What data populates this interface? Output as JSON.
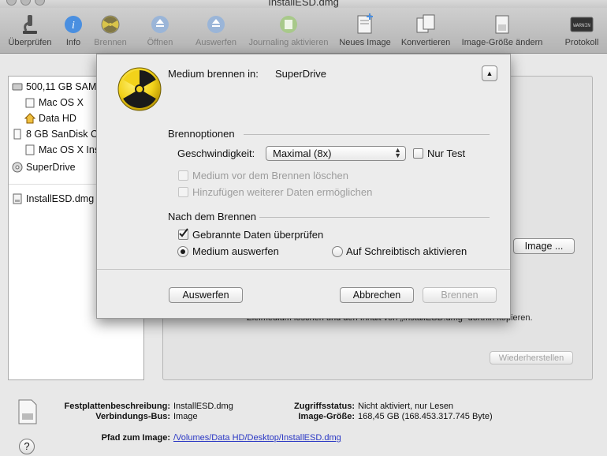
{
  "window": {
    "title": "InstallESD.dmg"
  },
  "toolbar": {
    "items": [
      {
        "label": "Überprüfen",
        "icon": "microscope-icon"
      },
      {
        "label": "Info",
        "icon": "info-icon"
      },
      {
        "label": "Brennen",
        "icon": "burn-icon"
      },
      {
        "label": "Öffnen",
        "icon": "eject-icon"
      },
      {
        "label": "Auswerfen",
        "icon": "eject-icon"
      },
      {
        "label": "Journaling aktivieren",
        "icon": "journaling-icon"
      },
      {
        "label": "Neues Image",
        "icon": "new-image-icon"
      },
      {
        "label": "Konvertieren",
        "icon": "convert-icon"
      },
      {
        "label": "Image-Größe ändern",
        "icon": "resize-image-icon"
      },
      {
        "label": "Protokoll",
        "icon": "log-icon"
      }
    ]
  },
  "sidebar": {
    "items": [
      {
        "label": "500,11 GB SAMSUNG",
        "icon": "hard-drive-icon"
      },
      {
        "label": "Mac OS X",
        "icon": "volume-icon"
      },
      {
        "label": "Data HD",
        "icon": "home-icon"
      },
      {
        "label": "8 GB SanDisk Cruzer B...",
        "icon": "usb-drive-icon"
      },
      {
        "label": "Mac OS X Install ESD",
        "icon": "volume-icon"
      },
      {
        "label": "SuperDrive",
        "icon": "optical-drive-icon"
      },
      {
        "label": "InstallESD.dmg",
        "icon": "disk-image-icon"
      }
    ]
  },
  "main": {
    "image_button": "Image ...",
    "restore_button": "Wiederherstellen",
    "description": "Zielmedium löschen und den Inhalt von „InstallESD.dmg“ dorthin kopieren."
  },
  "sheet": {
    "burn_to_label": "Medium brennen in:",
    "burn_to_value": "SuperDrive",
    "burn_options_heading": "Brennoptionen",
    "speed_label": "Geschwindigkeit:",
    "speed_value": "Maximal (8x)",
    "test_label": "Nur Test",
    "erase_label": "Medium vor dem Brennen löschen",
    "append_label": "Hinzufügen weiterer Daten ermöglichen",
    "after_burn_heading": "Nach dem Brennen",
    "verify_label": "Gebrannte Daten überprüfen",
    "eject_option_label": "Medium auswerfen",
    "mount_option_label": "Auf Schreibtisch aktivieren",
    "eject_button": "Auswerfen",
    "cancel_button": "Abbrechen",
    "burn_button": "Brennen"
  },
  "info": {
    "description_label": "Festplattenbeschreibung:",
    "description_value": "InstallESD.dmg",
    "bus_label": "Verbindungs-Bus:",
    "bus_value": "Image",
    "access_label": "Zugriffsstatus:",
    "access_value": "Nicht aktiviert, nur Lesen",
    "size_label": "Image-Größe:",
    "size_value": "168,45 GB (168.453.317.745 Byte)",
    "path_label": "Pfad zum Image:",
    "path_value": "/Volumes/Data HD/Desktop/InstallESD.dmg"
  },
  "colors": {
    "accent": "#2a37c4",
    "burn_yellow": "#f2d21a"
  }
}
